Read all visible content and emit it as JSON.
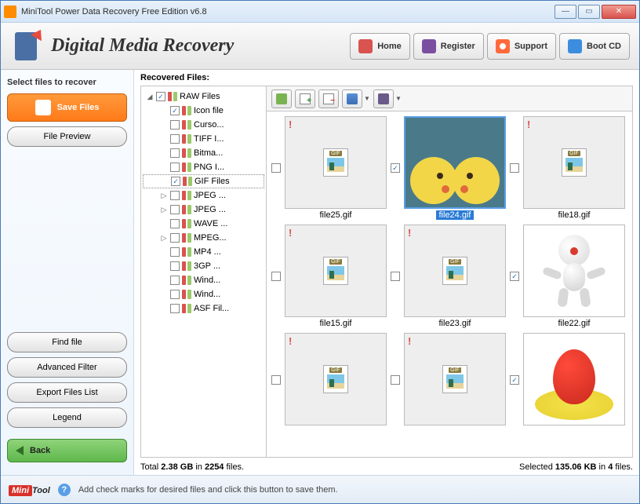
{
  "window": {
    "title": "MiniTool Power Data Recovery Free Edition v6.8"
  },
  "header": {
    "brand": "Digital Media Recovery",
    "buttons": {
      "home": "Home",
      "register": "Register",
      "support": "Support",
      "bootcd": "Boot CD"
    }
  },
  "sidebar": {
    "label": "Select files to recover",
    "save": "Save Files",
    "preview": "File Preview",
    "find": "Find file",
    "filter": "Advanced Filter",
    "export": "Export Files List",
    "legend": "Legend",
    "back": "Back"
  },
  "main": {
    "title": "Recovered Files:",
    "tree": {
      "root": "RAW Files",
      "items": [
        {
          "label": "Icon file",
          "checked": true
        },
        {
          "label": "Curso...",
          "checked": false
        },
        {
          "label": "TIFF I...",
          "checked": false
        },
        {
          "label": "Bitma...",
          "checked": false
        },
        {
          "label": "PNG I...",
          "checked": false
        },
        {
          "label": "GIF Files",
          "checked": true,
          "selected": true
        },
        {
          "label": "JPEG ...",
          "checked": false,
          "expandable": true
        },
        {
          "label": "JPEG ...",
          "checked": false,
          "expandable": true
        },
        {
          "label": "WAVE ...",
          "checked": false
        },
        {
          "label": "MPEG...",
          "checked": false,
          "expandable": true
        },
        {
          "label": "MP4 ...",
          "checked": false
        },
        {
          "label": "3GP ...",
          "checked": false
        },
        {
          "label": "Wind...",
          "checked": false
        },
        {
          "label": "Wind...",
          "checked": false
        },
        {
          "label": "ASF Fil...",
          "checked": false
        }
      ]
    },
    "thumbs": [
      {
        "name": "file25.gif",
        "checked": false,
        "warn": true,
        "kind": "gif"
      },
      {
        "name": "file24.gif",
        "checked": true,
        "warn": false,
        "kind": "pika",
        "selected": true
      },
      {
        "name": "file18.gif",
        "checked": false,
        "warn": true,
        "kind": "gif"
      },
      {
        "name": "file15.gif",
        "checked": false,
        "warn": true,
        "kind": "gif"
      },
      {
        "name": "file23.gif",
        "checked": false,
        "warn": true,
        "kind": "gif"
      },
      {
        "name": "file22.gif",
        "checked": true,
        "warn": true,
        "kind": "figure"
      },
      {
        "name": "",
        "checked": false,
        "warn": true,
        "kind": "gif"
      },
      {
        "name": "",
        "checked": false,
        "warn": true,
        "kind": "gif"
      },
      {
        "name": "",
        "checked": true,
        "warn": true,
        "kind": "egg"
      }
    ]
  },
  "status": {
    "total_pre": "Total ",
    "total_size": "2.38 GB",
    "total_mid": " in ",
    "total_files": "2254",
    "total_post": " files.",
    "sel_pre": "Selected ",
    "sel_size": "135.06 KB",
    "sel_mid": " in ",
    "sel_files": "4",
    "sel_post": " files."
  },
  "footer": {
    "logo_a": "Mini",
    "logo_b": "Tool",
    "hint": "Add check marks for desired files and click this button to save them."
  }
}
